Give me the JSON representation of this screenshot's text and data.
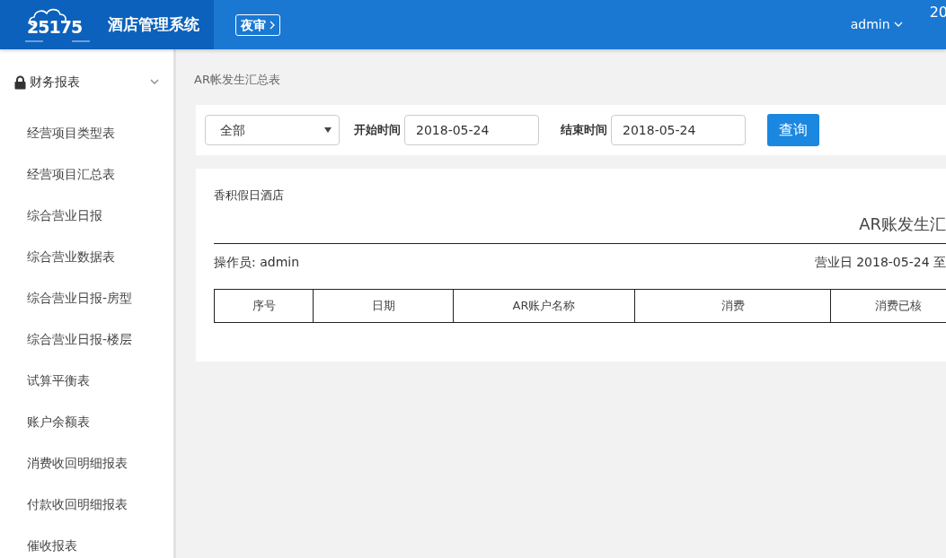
{
  "header": {
    "logo_text": "25175",
    "app_title": "酒店管理系统",
    "night_audit_button": "夜审",
    "user_menu": "admin",
    "clock_partial": "20"
  },
  "sidebar": {
    "group": {
      "label": "财务报表",
      "expanded": true,
      "items": [
        {
          "label": "经营项目类型表",
          "selected": false
        },
        {
          "label": "经营项目汇总表",
          "selected": false
        },
        {
          "label": "综合营业日报",
          "selected": false
        },
        {
          "label": "综合营业数据表",
          "selected": false
        },
        {
          "label": "综合营业日报-房型",
          "selected": false
        },
        {
          "label": "综合营业日报-楼层",
          "selected": false
        },
        {
          "label": "试算平衡表",
          "selected": false
        },
        {
          "label": "账户余额表",
          "selected": false
        },
        {
          "label": "消费收回明细报表",
          "selected": false
        },
        {
          "label": "付款收回明细报表",
          "selected": false
        },
        {
          "label": "催收报表",
          "selected": false
        }
      ]
    }
  },
  "breadcrumb": "AR帐发生汇总表",
  "filters": {
    "account_select": "全部",
    "start_label": "开始时间",
    "start_value": "2018-05-24",
    "end_label": "结束时间",
    "end_value": "2018-05-24",
    "query_button": "查询"
  },
  "report": {
    "hotel_name": "香积假日酒店",
    "title": "AR账发生汇",
    "operator": "操作员: admin",
    "business_day": "营业日 2018-05-24 至",
    "columns": [
      "序号",
      "日期",
      "AR账户名称",
      "消费",
      "消费已核"
    ]
  }
}
